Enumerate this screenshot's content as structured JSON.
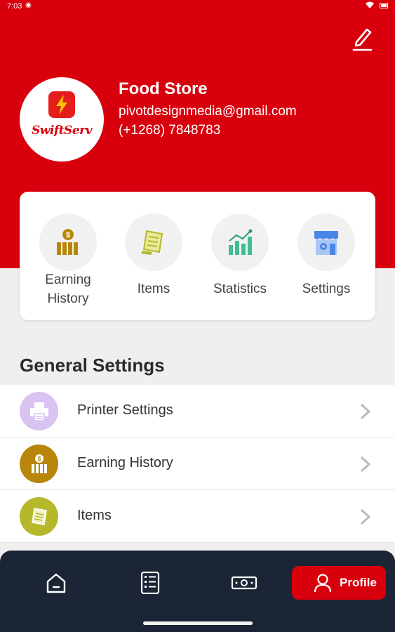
{
  "status_bar": {
    "time": "7:03"
  },
  "profile": {
    "store_name": "Food Store",
    "email": "pivotdesignmedia@gmail.com",
    "phone": "(+1268) 7848783",
    "logo_text": "SwiftServ"
  },
  "quick_actions": [
    {
      "label_line1": "Earning",
      "label_line2": "History",
      "icon": "money-stack-icon",
      "color": "#b8860b"
    },
    {
      "label": "Items",
      "icon": "receipt-icon",
      "color": "#b5b82a"
    },
    {
      "label": "Statistics",
      "icon": "chart-icon",
      "color": "#3fbf8f"
    },
    {
      "label": "Settings",
      "icon": "store-gear-icon",
      "color": "#4a86e8"
    }
  ],
  "general_settings": {
    "title": "General Settings",
    "items": [
      {
        "label": "Printer Settings",
        "icon": "printer-icon",
        "color": "#b89ad8"
      },
      {
        "label": "Earning History",
        "icon": "money-stack-icon",
        "color": "#b8860b"
      },
      {
        "label": "Items",
        "icon": "receipt-icon",
        "color": "#b5b82a"
      }
    ]
  },
  "bottom_nav": {
    "items": [
      "home-icon",
      "orders-icon",
      "cash-icon"
    ],
    "active_label": "Profile"
  },
  "colors": {
    "brand_red": "#d9000d",
    "nav_dark": "#1c2536"
  }
}
